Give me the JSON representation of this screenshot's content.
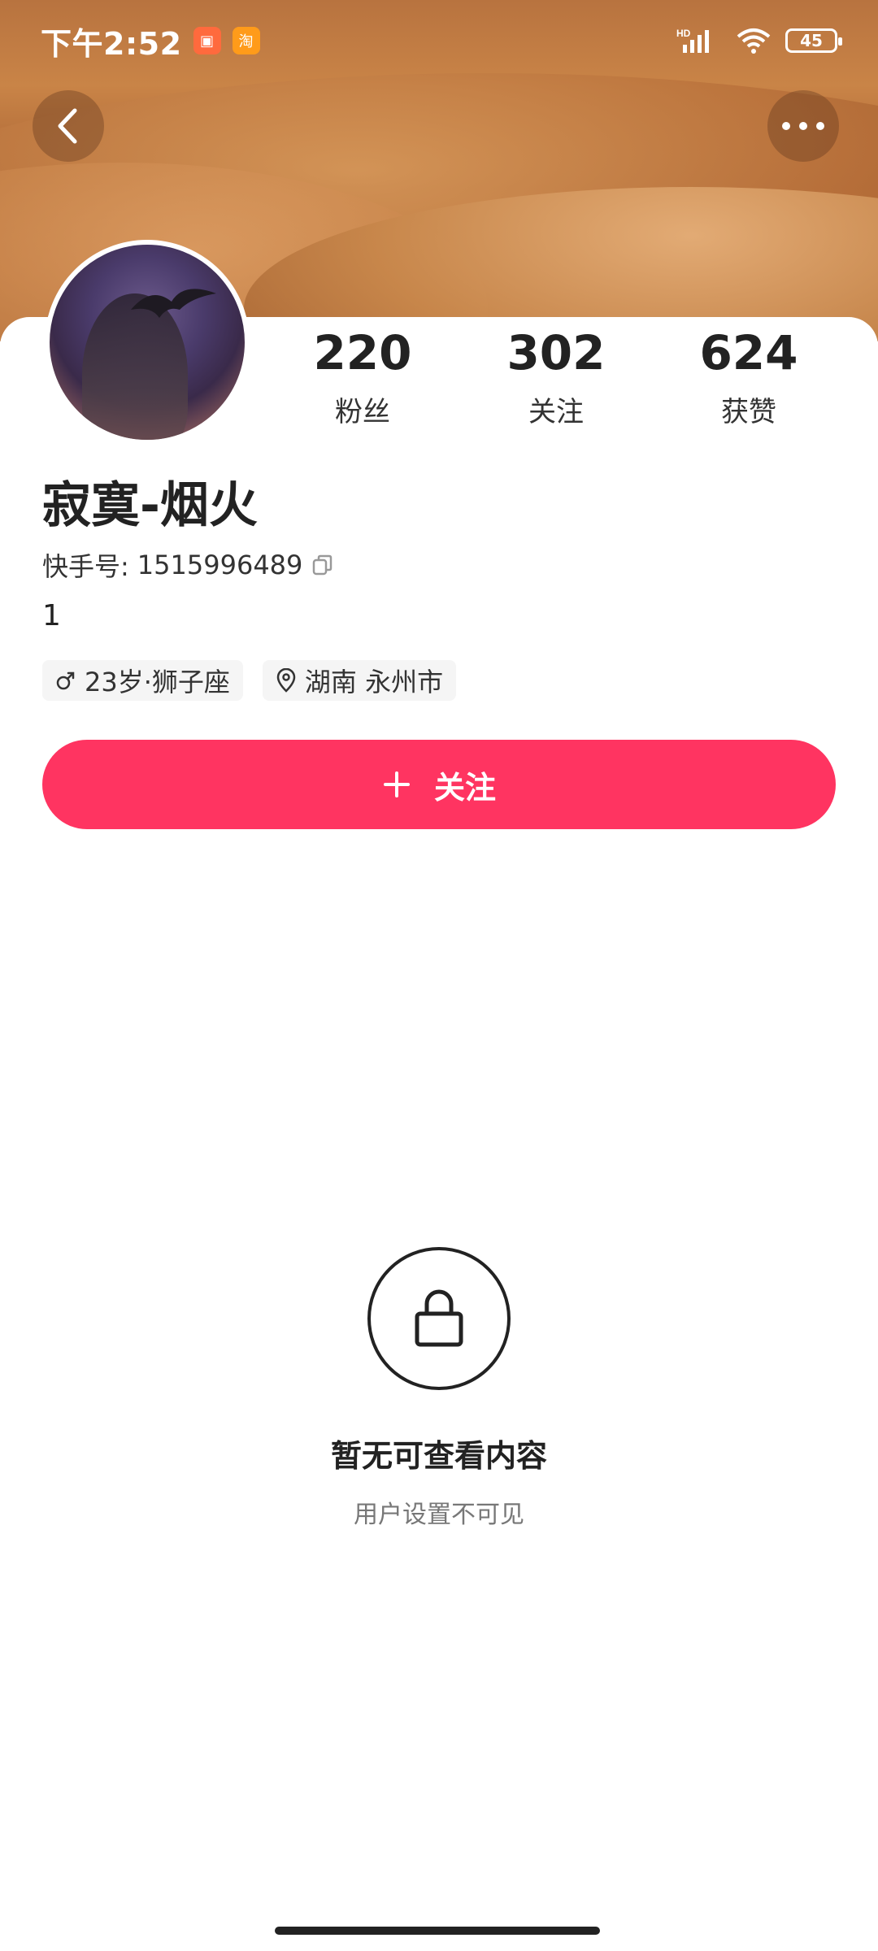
{
  "status_bar": {
    "time": "下午2:52",
    "network": "HD",
    "battery": "45"
  },
  "profile": {
    "name": "寂寞-烟火",
    "kuaishou_label": "快手号:",
    "kuaishou_id": "1515996489",
    "bio": "1",
    "tags": {
      "age_constellation": "23岁·狮子座",
      "location": "湖南 永州市"
    },
    "stats": [
      {
        "value": "220",
        "label": "粉丝"
      },
      {
        "value": "302",
        "label": "关注"
      },
      {
        "value": "624",
        "label": "获赞"
      }
    ]
  },
  "actions": {
    "follow_label": "关注"
  },
  "empty_state": {
    "title": "暂无可查看内容",
    "subtitle": "用户设置不可见"
  },
  "colors": {
    "accent": "#ff3461"
  }
}
